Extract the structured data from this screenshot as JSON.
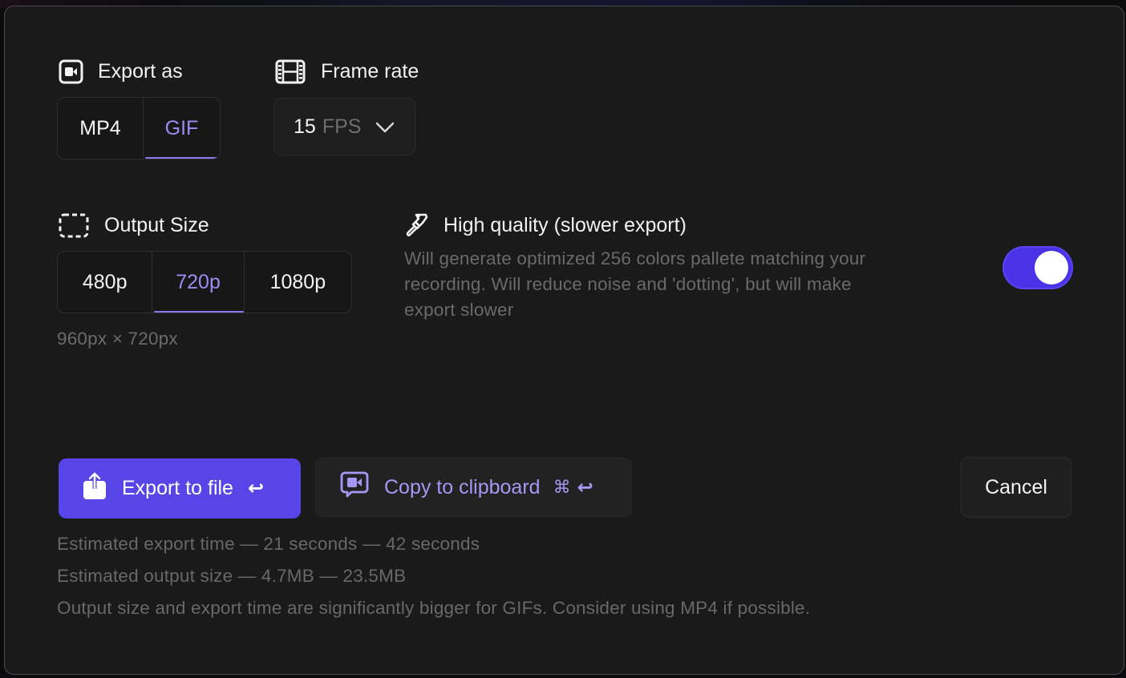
{
  "dialog": {
    "export_as": {
      "label": "Export as",
      "icon": "video-camera-icon",
      "options": [
        {
          "label": "MP4",
          "active": false
        },
        {
          "label": "GIF",
          "active": true
        }
      ]
    },
    "frame_rate": {
      "label": "Frame rate",
      "icon": "film-strip-icon",
      "value": "15",
      "unit": "FPS",
      "chevron_icon": "chevron-down-icon"
    },
    "output_size": {
      "label": "Output Size",
      "icon": "dashed-frame-icon",
      "options": [
        {
          "label": "480p",
          "active": false
        },
        {
          "label": "720p",
          "active": true
        },
        {
          "label": "1080p",
          "active": false
        }
      ],
      "dimensions": "960px × 720px"
    },
    "high_quality": {
      "label": "High quality (slower export)",
      "icon": "paint-brush-icon",
      "description_lines": [
        "Will generate optimized 256 colors pallete matching your",
        "recording. Will reduce noise and 'dotting', but will make",
        "export slower"
      ],
      "enabled": true
    },
    "actions": {
      "export_to_file": {
        "label": "Export to file",
        "icon": "share-upload-icon",
        "shortcut": "↩"
      },
      "copy_to_clipboard": {
        "label": "Copy to clipboard",
        "icon": "video-message-icon",
        "shortcut_cmd": "⌘",
        "shortcut_enter": "↩"
      },
      "cancel": {
        "label": "Cancel"
      }
    },
    "info": {
      "export_time": "Estimated export time — 21 seconds — 42 seconds",
      "output_size": "Estimated output size — 4.7MB — 23.5MB",
      "note": "Output size and export time are significantly bigger for GIFs. Consider using MP4 if possible."
    },
    "colors": {
      "accent": "#5845e8",
      "accent_text": "#9d8cf0",
      "toggle_on": "#4b32e6",
      "background": "#1a1a1a"
    }
  }
}
